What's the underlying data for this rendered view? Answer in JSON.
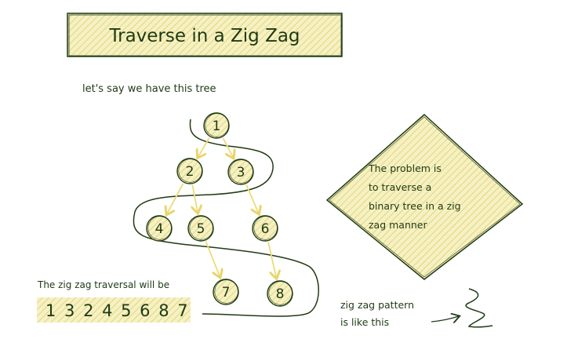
{
  "title": "Traverse in a Zig Zag",
  "intro_text": "let's say we have this tree",
  "nodes": [
    {
      "id": "n1",
      "label": "1"
    },
    {
      "id": "n2",
      "label": "2"
    },
    {
      "id": "n3",
      "label": "3"
    },
    {
      "id": "n4",
      "label": "4"
    },
    {
      "id": "n5",
      "label": "5"
    },
    {
      "id": "n6",
      "label": "6"
    },
    {
      "id": "n7",
      "label": "7"
    },
    {
      "id": "n8",
      "label": "8"
    }
  ],
  "edges": [
    [
      "n1",
      "n2"
    ],
    [
      "n1",
      "n3"
    ],
    [
      "n2",
      "n4"
    ],
    [
      "n2",
      "n5"
    ],
    [
      "n3",
      "n6"
    ],
    [
      "n5",
      "n7"
    ],
    [
      "n6",
      "n8"
    ]
  ],
  "problem_lines": [
    "The problem is",
    "to traverse a",
    "binary tree in a zig",
    "zag manner"
  ],
  "traversal_label": "The zig zag traversal will be",
  "traversal_sequence": "1 3 2 4 5 6 8 7",
  "pattern_lines": [
    "zig zag pattern",
    "is like this"
  ],
  "colors": {
    "ink": "#1f3a14",
    "highlight": "#f4efb2",
    "hatch": "#e6dc72",
    "arrow": "#eedb76"
  }
}
